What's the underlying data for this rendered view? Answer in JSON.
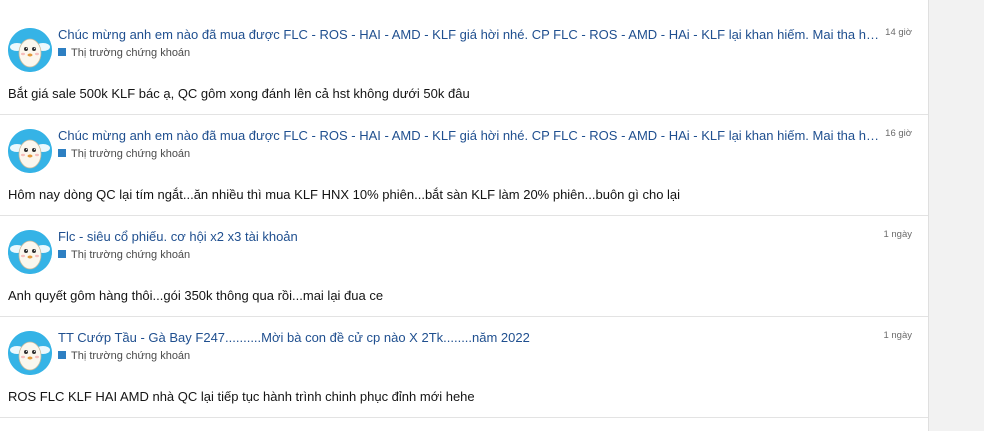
{
  "posts": [
    {
      "title": "Chúc mừng anh em nào đã mua được FLC - ROS - HAI - AMD - KLF giá hời nhé. CP FLC - ROS - AMD - HAi - KLF lại khan hiếm. Mai tha hồ tí…",
      "time": "14 giờ",
      "category": "Thị trường chứng khoán",
      "content": "Bắt giá sale 500k KLF bác ạ, QC gôm xong đánh lên cả hst không dưới 50k đâu"
    },
    {
      "title": "Chúc mừng anh em nào đã mua được FLC - ROS - HAI - AMD - KLF giá hời nhé. CP FLC - ROS - AMD - HAi - KLF lại khan hiếm. Mai tha hồ tí…",
      "time": "16 giờ",
      "category": "Thị trường chứng khoán",
      "content": "Hôm nay dòng QC lại tím ngắt...ăn nhiều thì mua KLF HNX 10% phiên...bắt sàn KLF làm 20% phiên...buôn gì cho lại"
    },
    {
      "title": "Flc - siêu cổ phiếu. cơ hội x2 x3 tài khoản",
      "time": "1 ngày",
      "category": "Thị trường chứng khoán",
      "content": "Anh quyết gôm hàng thôi...gói 350k thông qua rồi...mai lại đua ce"
    },
    {
      "title": "TT Cướp Tầu - Gà Bay F247..........Mời bà con đề cử cp nào X 2Tk........năm 2022",
      "time": "1 ngày",
      "category": "Thị trường chứng khoán",
      "content": "ROS FLC KLF HAI AMD nhà QC lại tiếp tục hành trình chinh phục đỉnh mới hehe"
    }
  ],
  "colors": {
    "link": "#1f4f8f",
    "category_square": "#2d7fc2",
    "avatar_bg": "#35b3e6"
  }
}
